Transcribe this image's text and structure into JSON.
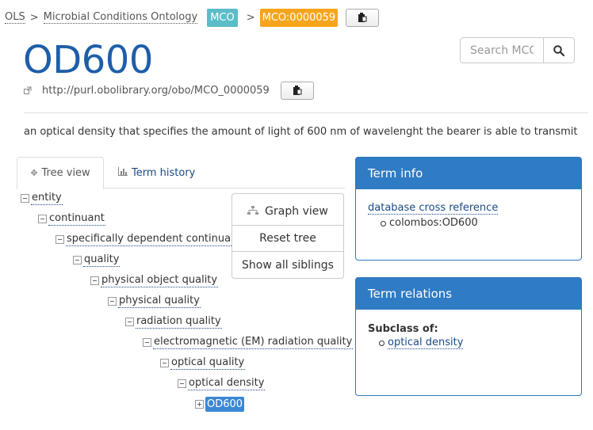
{
  "breadcrumb": {
    "root": "OLS",
    "ontology": "Microbial Conditions Ontology",
    "ontology_badge": "MCO",
    "term_badge": "MCO:0000059",
    "separator": ">"
  },
  "term": {
    "label": "OD600",
    "iri": "http://purl.obolibrary.org/obo/MCO_0000059",
    "description": "an optical density that specifies the amount of light of 600 nm of wavelenght the bearer is able to transmit"
  },
  "search": {
    "placeholder": "Search MCO"
  },
  "tabs": [
    {
      "label": "Tree view"
    },
    {
      "label": "Term history"
    }
  ],
  "tree": {
    "nodes": [
      {
        "label": "entity"
      },
      {
        "label": "continuant"
      },
      {
        "label": "specifically dependent continua"
      },
      {
        "label": "quality"
      },
      {
        "label": "physical object quality"
      },
      {
        "label": "physical quality"
      },
      {
        "label": "radiation quality"
      },
      {
        "label": "electromagnetic (EM) radiation quality"
      },
      {
        "label": "optical quality"
      },
      {
        "label": "optical density"
      },
      {
        "label": "OD600"
      }
    ],
    "buttons": {
      "graph": "Graph view",
      "reset": "Reset tree",
      "siblings": "Show all siblings"
    }
  },
  "term_info": {
    "title": "Term info",
    "xref_heading": "database cross reference",
    "xrefs": [
      "colombos:OD600"
    ]
  },
  "term_relations": {
    "title": "Term relations",
    "subclass_heading": "Subclass of:",
    "subclass_of": [
      "optical density"
    ]
  },
  "colors": {
    "title_blue": "#1e5ea8",
    "panel_header": "#2f7bc4",
    "ontology_badge": "#5bbdc8",
    "term_badge": "#f7a51d",
    "selected_node": "#3a87d6"
  }
}
